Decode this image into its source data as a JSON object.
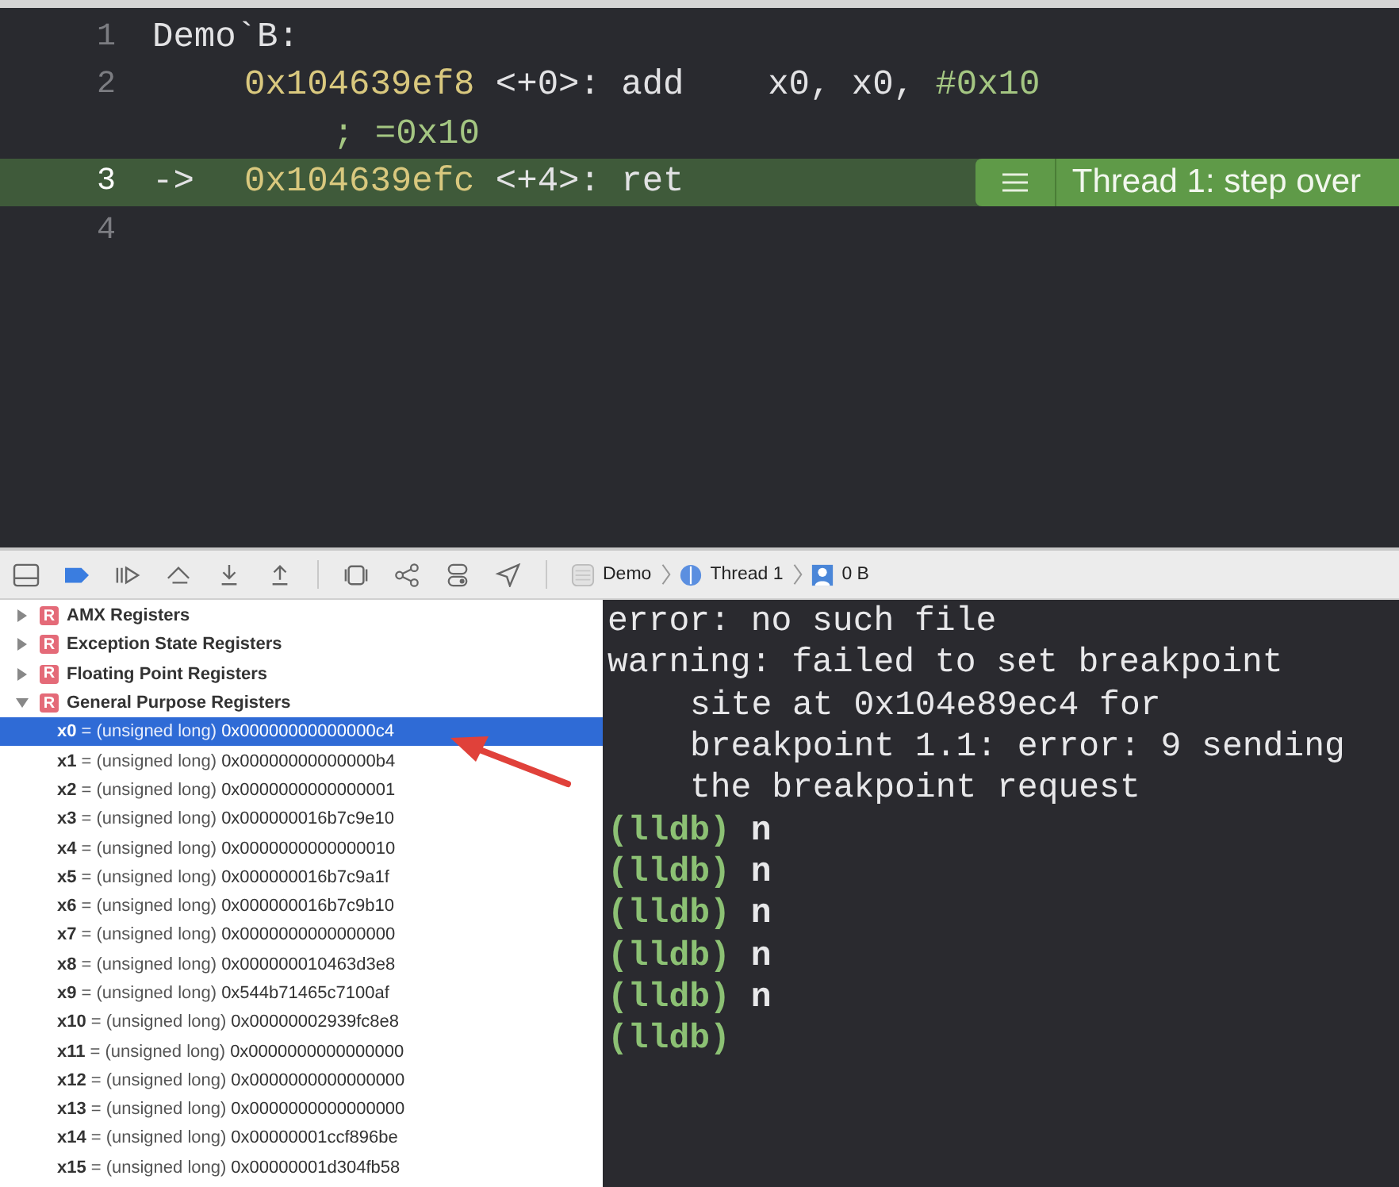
{
  "editor": {
    "lines": [
      {
        "number": "1",
        "current": false,
        "segments": [
          {
            "kind": "plain",
            "text": "Demo`B:"
          }
        ]
      },
      {
        "number": "2",
        "current": false,
        "segments": [
          {
            "kind": "address",
            "text": "0x104639ef8"
          },
          {
            "kind": "plain",
            "text": " <+0>: add    x0, x0, "
          },
          {
            "kind": "number",
            "text": "#0x10"
          }
        ],
        "continuation": [
          {
            "kind": "comment",
            "text": "; =0x10"
          }
        ]
      },
      {
        "number": "3",
        "current": true,
        "marker": "->",
        "segments": [
          {
            "kind": "address",
            "text": "0x104639efc"
          },
          {
            "kind": "plain",
            "text": " <+4>: ret"
          }
        ]
      },
      {
        "number": "4",
        "current": false
      }
    ],
    "thread_badge": "Thread 1: step over"
  },
  "breadcrumb": [
    {
      "kind": "app",
      "label": "Demo"
    },
    {
      "kind": "thread",
      "label": "Thread 1"
    },
    {
      "kind": "frame",
      "label": "0 B"
    }
  ],
  "variables": [
    {
      "badge": "R",
      "label": "AMX Registers",
      "expanded": false
    },
    {
      "badge": "R",
      "label": "Exception State Registers",
      "expanded": false
    },
    {
      "badge": "R",
      "label": "Floating Point Registers",
      "expanded": false
    },
    {
      "badge": "R",
      "label": "General Purpose Registers",
      "expanded": true,
      "children": [
        {
          "name": "x0",
          "type": "= (unsigned long)",
          "value": "0x00000000000000c4",
          "selected": true
        },
        {
          "name": "x1",
          "type": "= (unsigned long)",
          "value": "0x00000000000000b4",
          "selected": false
        },
        {
          "name": "x2",
          "type": "= (unsigned long)",
          "value": "0x0000000000000001",
          "selected": false
        },
        {
          "name": "x3",
          "type": "= (unsigned long)",
          "value": "0x000000016b7c9e10",
          "selected": false
        },
        {
          "name": "x4",
          "type": "= (unsigned long)",
          "value": "0x0000000000000010",
          "selected": false
        },
        {
          "name": "x5",
          "type": "= (unsigned long)",
          "value": "0x000000016b7c9a1f",
          "selected": false
        },
        {
          "name": "x6",
          "type": "= (unsigned long)",
          "value": "0x000000016b7c9b10",
          "selected": false
        },
        {
          "name": "x7",
          "type": "= (unsigned long)",
          "value": "0x0000000000000000",
          "selected": false
        },
        {
          "name": "x8",
          "type": "= (unsigned long)",
          "value": "0x000000010463d3e8",
          "selected": false
        },
        {
          "name": "x9",
          "type": "= (unsigned long)",
          "value": "0x544b71465c7100af",
          "selected": false
        },
        {
          "name": "x10",
          "type": "= (unsigned long)",
          "value": "0x00000002939fc8e8",
          "selected": false
        },
        {
          "name": "x11",
          "type": "= (unsigned long)",
          "value": "0x0000000000000000",
          "selected": false
        },
        {
          "name": "x12",
          "type": "= (unsigned long)",
          "value": "0x0000000000000000",
          "selected": false
        },
        {
          "name": "x13",
          "type": "= (unsigned long)",
          "value": "0x0000000000000000",
          "selected": false
        },
        {
          "name": "x14",
          "type": "= (unsigned long)",
          "value": "0x00000001ccf896be",
          "selected": false
        },
        {
          "name": "x15",
          "type": "= (unsigned long)",
          "value": "0x00000001d304fb58",
          "selected": false
        }
      ]
    }
  ],
  "console": [
    {
      "kind": "output",
      "text": "error: no such file"
    },
    {
      "kind": "output",
      "text": "warning: failed to set breakpoint"
    },
    {
      "kind": "continuation",
      "text": "site at 0x104e89ec4 for"
    },
    {
      "kind": "continuation",
      "text": "breakpoint 1.1: error: 9 sending"
    },
    {
      "kind": "continuation",
      "text": "the breakpoint request"
    },
    {
      "kind": "prompt",
      "prompt": "(lldb)",
      "text": "n"
    },
    {
      "kind": "prompt",
      "prompt": "(lldb)",
      "text": "n"
    },
    {
      "kind": "prompt",
      "prompt": "(lldb)",
      "text": "n"
    },
    {
      "kind": "prompt",
      "prompt": "(lldb)",
      "text": "n"
    },
    {
      "kind": "prompt",
      "prompt": "(lldb)",
      "text": "n"
    },
    {
      "kind": "prompt",
      "prompt": "(lldb)"
    }
  ]
}
